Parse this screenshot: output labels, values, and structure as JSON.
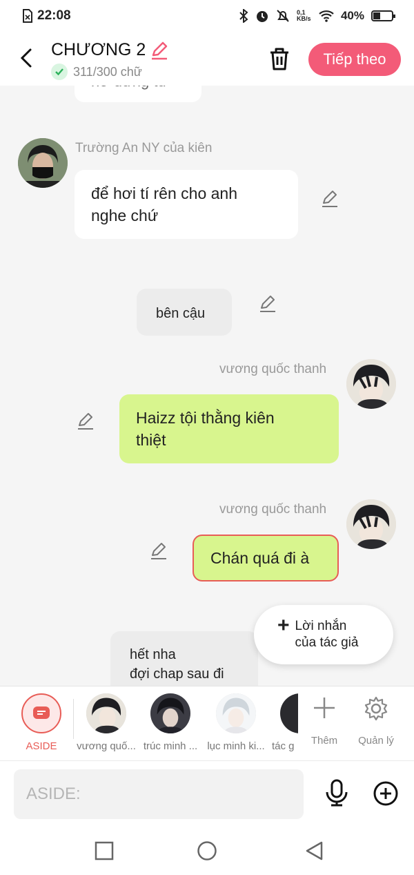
{
  "status": {
    "time": "22:08",
    "net_speed": "0,1\nKB/s",
    "battery": "40%",
    "battery_level": 0.4
  },
  "header": {
    "title": "CHƯƠNG 2",
    "word_count": "311/300 chữ",
    "next_label": "Tiếp theo"
  },
  "messages": {
    "top_partial": "hơ đừng từ",
    "m1": {
      "sender": "Trường An NY của kiên",
      "text": "để hơi tí rên cho anh\nnghe chứ"
    },
    "m2": {
      "text": "bên cậu"
    },
    "m3": {
      "sender": "vương quốc thanh",
      "text": "Haizz tội thằng kiên\nthiệt"
    },
    "m4": {
      "sender": "vương quốc thanh",
      "text": "Chán quá đi à"
    },
    "m5": {
      "text": "hết nha\nđợi chap sau đi"
    }
  },
  "author_note": {
    "label": "Lời nhắn\ncủa tác giả"
  },
  "characters": [
    {
      "label": "ASIDE"
    },
    {
      "label": "vương quố..."
    },
    {
      "label": "trúc minh ..."
    },
    {
      "label": "lục minh ki..."
    },
    {
      "label": "tác g"
    }
  ],
  "tools": {
    "add_label": "Thêm",
    "manage_label": "Quản lý"
  },
  "input": {
    "placeholder": "ASIDE:"
  },
  "colors": {
    "accent": "#f35b78",
    "green_bubble": "#d8f58e",
    "selected_border": "#e85c56"
  }
}
